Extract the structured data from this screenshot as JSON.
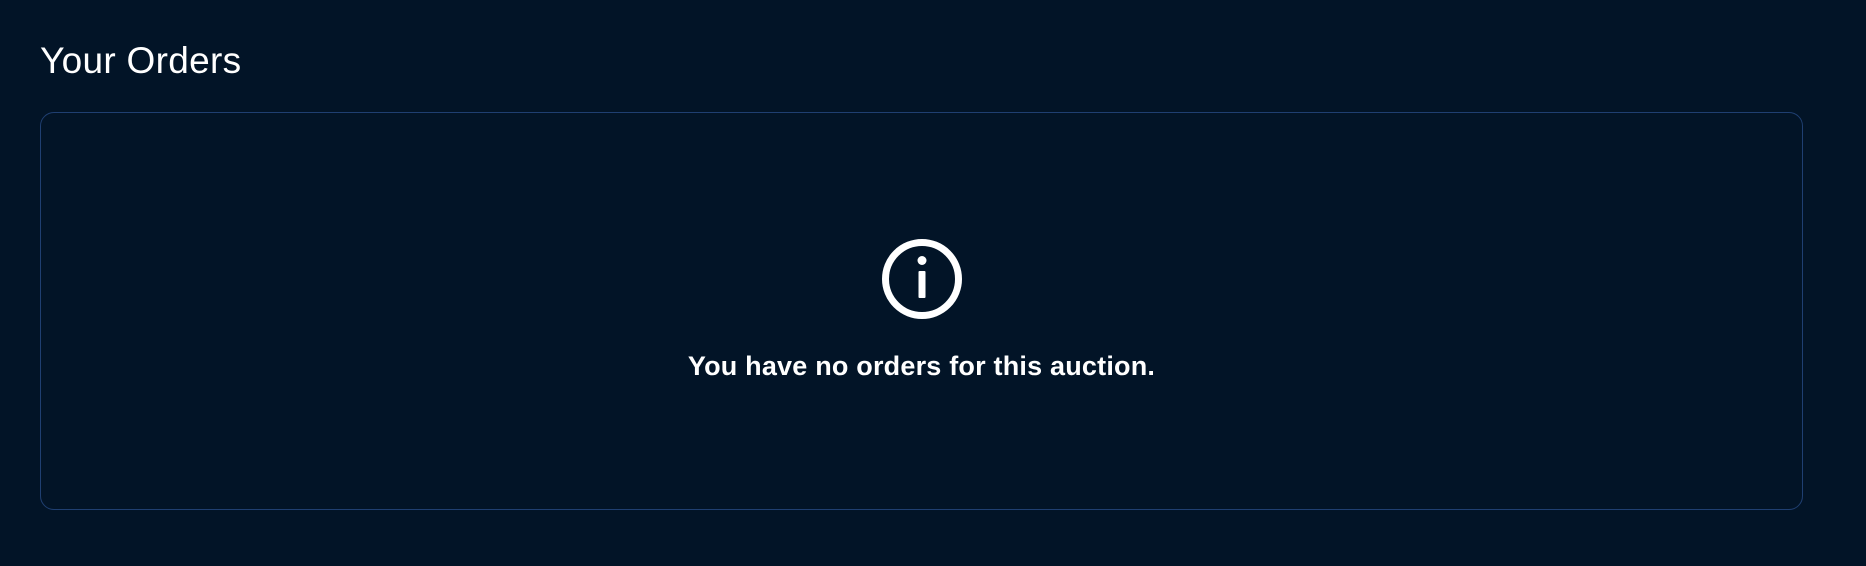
{
  "orders": {
    "title": "Your Orders",
    "empty_state": {
      "icon": "info-icon",
      "message": "You have no orders for this auction."
    }
  },
  "colors": {
    "background": "#021427",
    "card_border": "#1f3f71",
    "text": "#ffffff"
  }
}
